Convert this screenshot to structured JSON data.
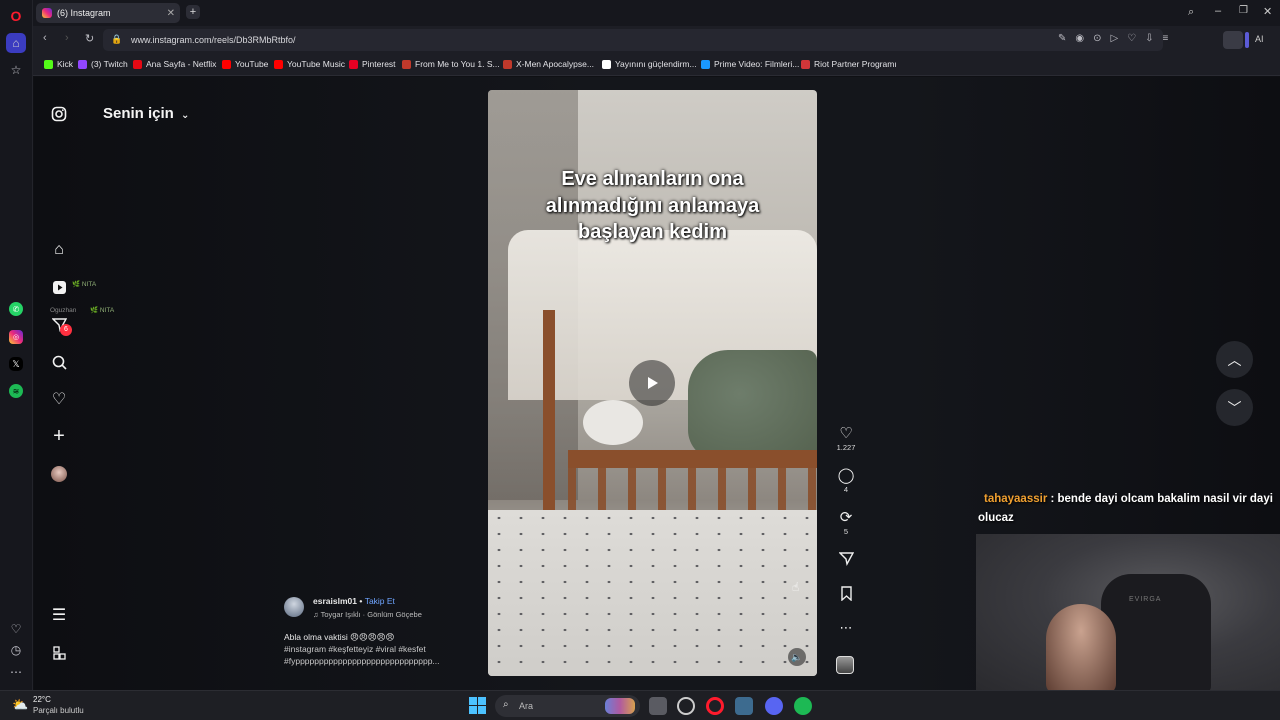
{
  "browser": {
    "tab_title": "(6) Instagram",
    "url": "www.instagram.com/reels/Db3RMbRtbfo/",
    "ai_label": "AI",
    "bookmarks": [
      {
        "label": "Kick",
        "color": "#53fc18"
      },
      {
        "label": "(3) Twitch",
        "color": "#9146ff"
      },
      {
        "label": "Ana Sayfa - Netflix",
        "color": "#e50914"
      },
      {
        "label": "YouTube",
        "color": "#ff0000"
      },
      {
        "label": "YouTube Music",
        "color": "#ff0000"
      },
      {
        "label": "Pinterest",
        "color": "#e60023"
      },
      {
        "label": "From Me to You 1. S...",
        "color": "#c0392b"
      },
      {
        "label": "X-Men Apocalypse...",
        "color": "#c0392b"
      },
      {
        "label": "Yayınını güçlendirm...",
        "color": "#ffffff"
      },
      {
        "label": "Prime Video: Filmleri...",
        "color": "#1a98ff"
      },
      {
        "label": "Riot Partner Programı",
        "color": "#d13639"
      }
    ]
  },
  "instagram": {
    "feed_title": "Senin için",
    "sidebar_overlay": {
      "badge_text": "NITA",
      "user_name": "Oguzhan",
      "notification_count": "6"
    },
    "video": {
      "caption_lines": [
        "Eve alınanların ona",
        "alınmadığını anlamaya",
        "başlayan kedim"
      ]
    },
    "actions": {
      "likes": "1.227",
      "comments": "4",
      "reposts": "5"
    },
    "post": {
      "username": "esraislm01",
      "separator": "•",
      "follow_label": "Takip Et",
      "music": "Toygar Işıklı · Gönlüm Göçebe",
      "caption": "Abla olma vaktisi 😠😠😠😠😠",
      "hashtags": "#instagram #keşfetteyiz #viral #kesfet",
      "hashtags2": "#fyppppppppppppppppppppppppppppp..."
    }
  },
  "chat": {
    "user": "tahayaassir",
    "message": " : bende dayi olcam bakalim nasil vir dayi olucaz",
    "user_color": "#f0a030"
  },
  "webcam": {
    "chair_brand": "EVIRGA"
  },
  "taskbar": {
    "temperature": "22°C",
    "weather": "Parçalı bulutlu",
    "search_placeholder": "Ara"
  }
}
